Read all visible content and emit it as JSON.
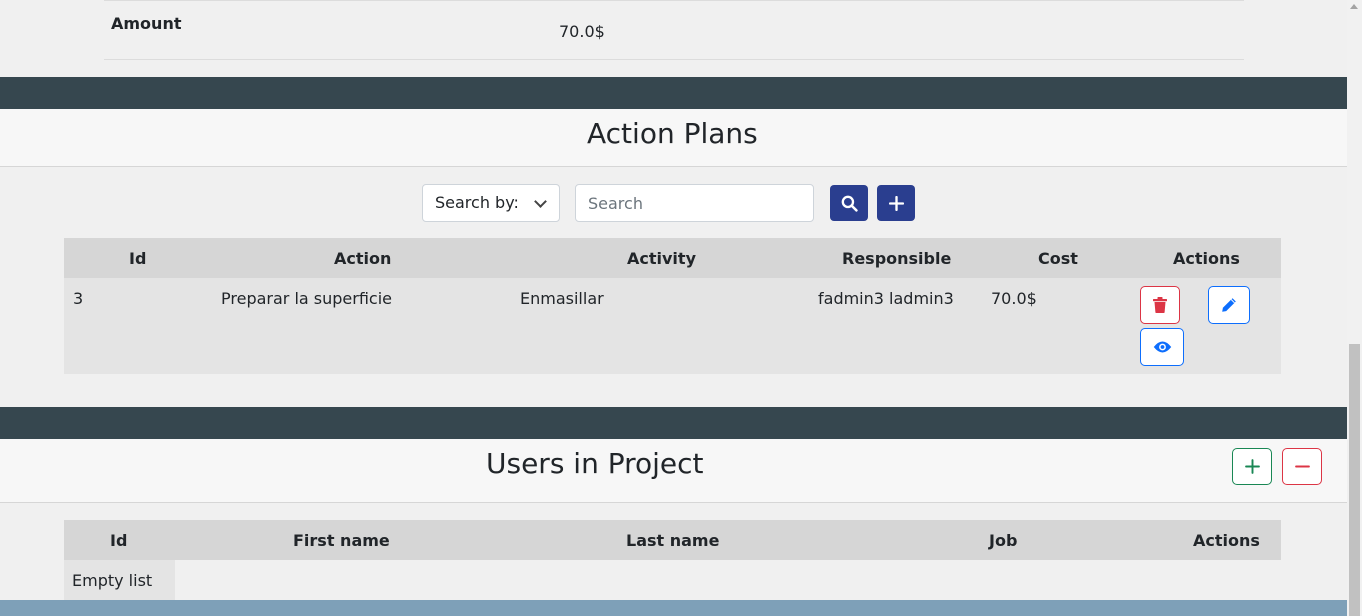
{
  "budget": {
    "amount_label": "Amount",
    "amount_value": "70.0$"
  },
  "action_plans": {
    "title": "Action Plans",
    "search_by_label": "Search by:",
    "search_placeholder": "Search",
    "columns": [
      "Id",
      "Action",
      "Activity",
      "Responsible",
      "Cost",
      "Actions"
    ],
    "rows": [
      {
        "id": "3",
        "action": "Preparar la superficie",
        "activity": "Enmasillar",
        "responsible": "fadmin3 ladmin3",
        "cost": "70.0$"
      }
    ]
  },
  "users_in_project": {
    "title": "Users in Project",
    "columns": [
      "Id",
      "First name",
      "Last name",
      "Job",
      "Actions"
    ],
    "empty_text": "Empty list"
  },
  "icons": {
    "search": "search-icon",
    "add": "plus-icon",
    "delete": "trash-icon",
    "edit": "pencil-icon",
    "view": "eye-icon",
    "remove": "minus-icon"
  },
  "colors": {
    "band": "#36474f",
    "primary": "#2a3e8f",
    "danger": "#dc3545",
    "info": "#0d6efd",
    "success": "#198754",
    "footer": "#7ea0b8"
  }
}
